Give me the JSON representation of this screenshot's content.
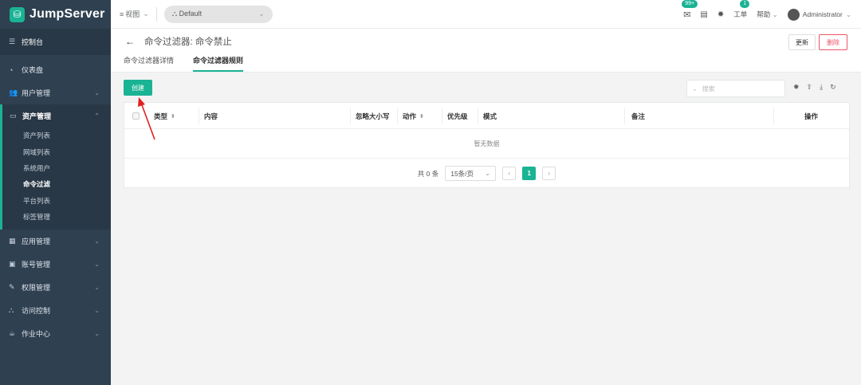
{
  "brand": {
    "name": "JumpServer",
    "accent": "#1ab394",
    "sidebar_bg": "#2f4050"
  },
  "sidebar": {
    "console": "控制台",
    "items": [
      {
        "label": "仪表盘",
        "icon": "dashboard-icon"
      },
      {
        "label": "用户管理",
        "icon": "users-icon",
        "expandable": true
      },
      {
        "label": "资产管理",
        "icon": "inbox-icon",
        "expandable": true,
        "expanded": true
      },
      {
        "label": "应用管理",
        "icon": "grid-icon",
        "expandable": true
      },
      {
        "label": "账号管理",
        "icon": "address-book-icon",
        "expandable": true
      },
      {
        "label": "权限管理",
        "icon": "edit-icon",
        "expandable": true
      },
      {
        "label": "访问控制",
        "icon": "sitemap-icon",
        "expandable": true
      },
      {
        "label": "作业中心",
        "icon": "coffee-icon",
        "expandable": true
      }
    ],
    "asset_sub": [
      "资产列表",
      "网域列表",
      "系统用户",
      "命令过滤",
      "平台列表",
      "标签管理"
    ],
    "active_sub": "命令过滤"
  },
  "topbar": {
    "view": "视图",
    "org": "Default",
    "mail_badge": "99+",
    "ticket_label": "工单",
    "ticket_badge": "1",
    "help": "帮助",
    "user": "Administrator"
  },
  "page": {
    "title": "命令过滤器: 命令禁止",
    "update_btn": "更新",
    "delete_btn": "删除",
    "tabs": [
      "命令过滤器详情",
      "命令过滤器规则"
    ],
    "active_tab": "命令过滤器规则"
  },
  "toolbar": {
    "create": "创建",
    "search_placeholder": "搜索"
  },
  "table": {
    "columns": [
      "类型",
      "内容",
      "忽略大小写",
      "动作",
      "优先级",
      "模式",
      "备注",
      "操作"
    ],
    "empty_text": "暂无数据"
  },
  "pagination": {
    "total": "共 0 条",
    "page_size": "15条/页",
    "current": "1"
  }
}
